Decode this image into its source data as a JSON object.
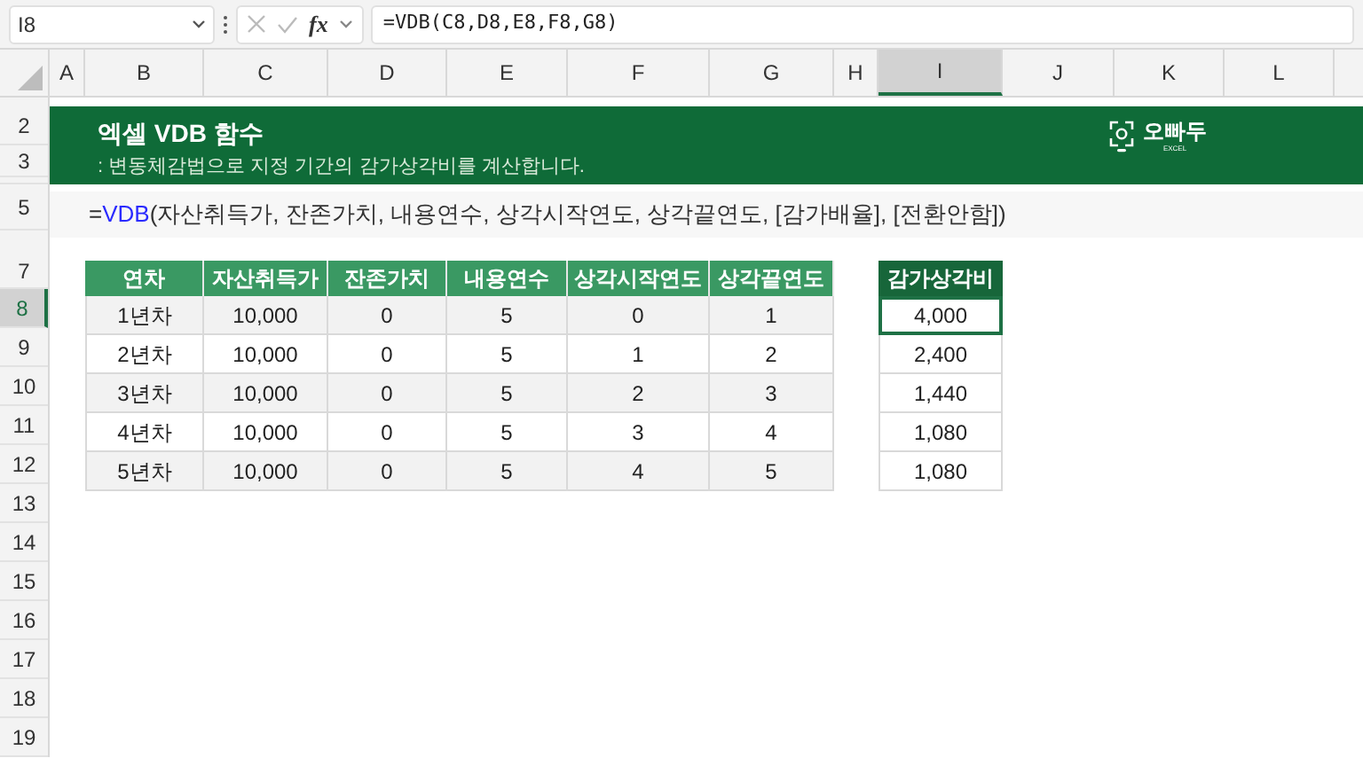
{
  "formula_bar": {
    "name_box": "I8",
    "fx_label": "fx",
    "formula": "=VDB(C8,D8,E8,F8,G8)"
  },
  "columns": [
    {
      "label": "A",
      "selected": false
    },
    {
      "label": "B",
      "selected": false
    },
    {
      "label": "C",
      "selected": false
    },
    {
      "label": "D",
      "selected": false
    },
    {
      "label": "E",
      "selected": false
    },
    {
      "label": "F",
      "selected": false
    },
    {
      "label": "G",
      "selected": false
    },
    {
      "label": "H",
      "selected": false
    },
    {
      "label": "I",
      "selected": true
    },
    {
      "label": "J",
      "selected": false
    },
    {
      "label": "K",
      "selected": false
    },
    {
      "label": "L",
      "selected": false
    }
  ],
  "rows": [
    {
      "label": "2",
      "selected": false
    },
    {
      "label": "3",
      "selected": false
    },
    {
      "label": "5",
      "selected": false
    },
    {
      "label": "7",
      "selected": false
    },
    {
      "label": "8",
      "selected": true
    },
    {
      "label": "9",
      "selected": false
    },
    {
      "label": "10",
      "selected": false
    },
    {
      "label": "11",
      "selected": false
    },
    {
      "label": "12",
      "selected": false
    },
    {
      "label": "13",
      "selected": false
    },
    {
      "label": "14",
      "selected": false
    },
    {
      "label": "15",
      "selected": false
    },
    {
      "label": "16",
      "selected": false
    },
    {
      "label": "17",
      "selected": false
    },
    {
      "label": "18",
      "selected": false
    },
    {
      "label": "19",
      "selected": false
    }
  ],
  "banner": {
    "title": "엑셀 VDB 함수",
    "subtitle": ": 변동체감법으로 지정 기간의 감가상각비를 계산합니다.",
    "logo_text": "오빠두",
    "logo_subtext": "EXCEL"
  },
  "syntax": {
    "prefix": "=",
    "function": "VDB",
    "arguments": "(자산취득가, 잔존가치, 내용연수, 상각시작연도, 상각끝연도, [감가배율], [전환안함])"
  },
  "table": {
    "columns": [
      "연차",
      "자산취득가",
      "잔존가치",
      "내용연수",
      "상각시작연도",
      "상각끝연도"
    ],
    "rows": [
      [
        "1년차",
        "10,000",
        "0",
        "5",
        "0",
        "1"
      ],
      [
        "2년차",
        "10,000",
        "0",
        "5",
        "1",
        "2"
      ],
      [
        "3년차",
        "10,000",
        "0",
        "5",
        "2",
        "3"
      ],
      [
        "4년차",
        "10,000",
        "0",
        "5",
        "3",
        "4"
      ],
      [
        "5년차",
        "10,000",
        "0",
        "5",
        "4",
        "5"
      ]
    ]
  },
  "result": {
    "header": "감가상각비",
    "cells": [
      {
        "value": "4,000",
        "selected": true
      },
      {
        "value": "2,400",
        "selected": false
      },
      {
        "value": "1,440",
        "selected": false
      },
      {
        "value": "1,080",
        "selected": false
      },
      {
        "value": "1,080",
        "selected": false
      }
    ]
  }
}
